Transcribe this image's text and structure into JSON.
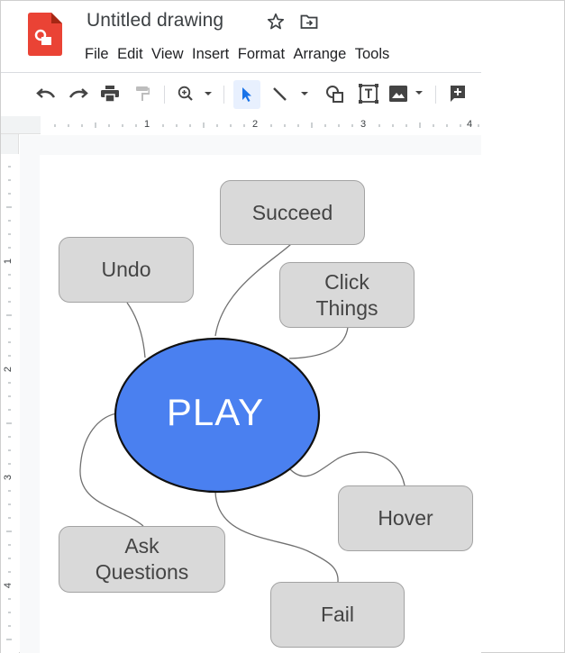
{
  "app": {
    "doc_title": "Untitled drawing"
  },
  "menu": [
    "File",
    "Edit",
    "View",
    "Insert",
    "Format",
    "Arrange",
    "Tools"
  ],
  "toolbar": {
    "icons": [
      "undo-icon",
      "redo-icon",
      "print-icon",
      "paint-format-icon",
      "zoom-icon",
      "select-icon",
      "line-icon",
      "shape-icon",
      "text-box-icon",
      "image-icon",
      "add-comment-icon"
    ],
    "active_tool": "select"
  },
  "ruler": {
    "horizontal_labels": [
      "1",
      "2",
      "3",
      "4"
    ],
    "vertical_labels": [
      "1",
      "2",
      "3",
      "4"
    ]
  },
  "diagram": {
    "center": "PLAY",
    "nodes": {
      "succeed": "Succeed",
      "undo": "Undo",
      "click_things": "Click\nThings",
      "hover": "Hover",
      "ask_questions": "Ask\nQuestions",
      "fail": "Fail"
    }
  },
  "colors": {
    "center_fill": "#4a80f0",
    "node_fill": "#d9d9d9",
    "node_border": "#a3a3a3",
    "logo_red": "#ea4335",
    "select_highlight": "#e8f0fe"
  }
}
